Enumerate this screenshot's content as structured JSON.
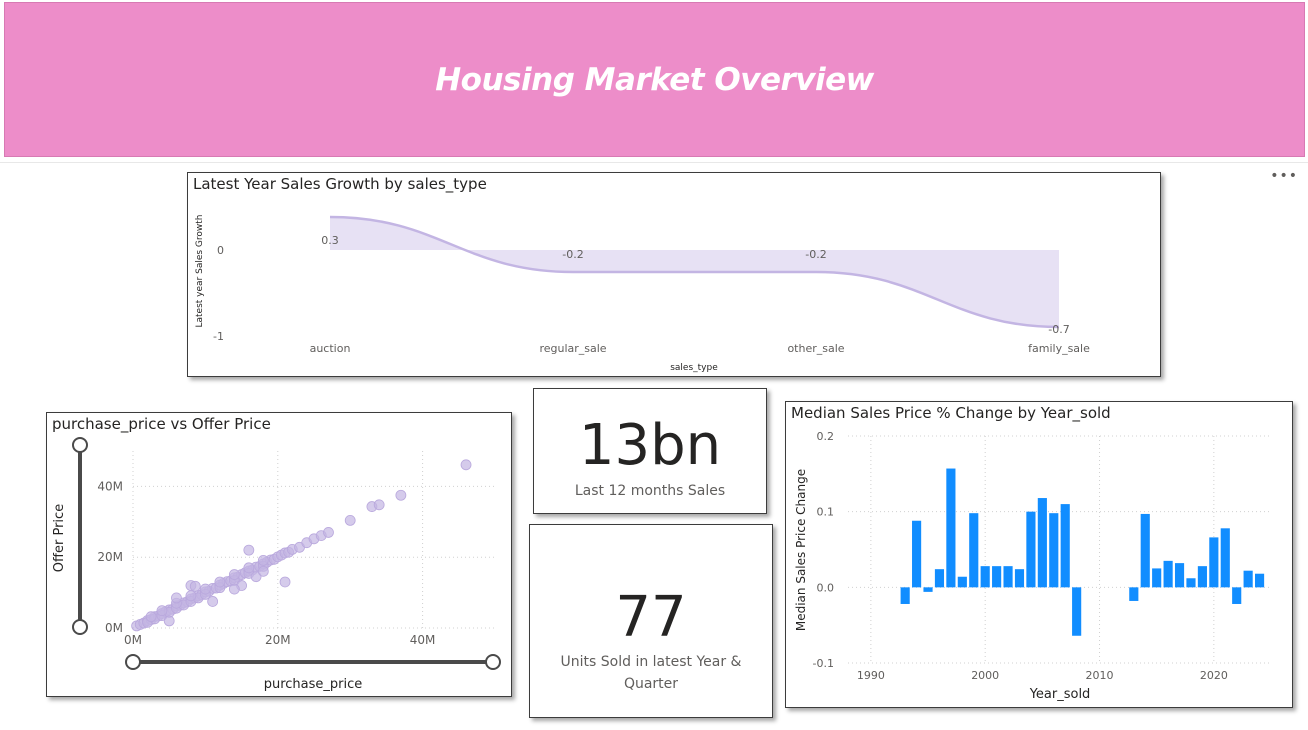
{
  "banner": {
    "title": "Housing Market Overview"
  },
  "visual_options_icon": "more-options-icon",
  "growth_chart": {
    "title": "Latest Year Sales Growth by sales_type",
    "chart_data": {
      "type": "area",
      "title": "Latest Year Sales Growth by sales_type",
      "xlabel": "sales_type",
      "ylabel": "Latest year Sales Growth",
      "categories": [
        "auction",
        "regular_sale",
        "other_sale",
        "family_sale"
      ],
      "values": [
        0.3,
        -0.2,
        -0.2,
        -0.7
      ],
      "data_labels": [
        "0.3",
        "-0.2",
        "-0.2",
        "-0.7"
      ],
      "y_ticks": [
        "0",
        "-1"
      ],
      "grid": false,
      "color": "#c3b5e3"
    }
  },
  "scatter_chart": {
    "title": "purchase_price vs Offer Price",
    "chart_data": {
      "type": "scatter",
      "title": "purchase_price vs Offer Price",
      "xlabel": "purchase_price",
      "ylabel": "Offer Price",
      "xlim": [
        0,
        50
      ],
      "ylim": [
        0,
        50
      ],
      "x_ticks": [
        "0M",
        "20M",
        "40M"
      ],
      "y_ticks": [
        "0M",
        "20M",
        "40M"
      ],
      "grid": true,
      "color": "#c3b5e3",
      "points": [
        [
          0.5,
          0.6
        ],
        [
          1,
          1
        ],
        [
          1.5,
          1.4
        ],
        [
          2,
          2.1
        ],
        [
          2.5,
          2.4
        ],
        [
          3,
          3.2
        ],
        [
          3.5,
          3.4
        ],
        [
          4,
          4.1
        ],
        [
          4.5,
          4.6
        ],
        [
          5,
          5.1
        ],
        [
          5.5,
          5.3
        ],
        [
          6,
          6.2
        ],
        [
          6.5,
          6.4
        ],
        [
          7,
          7.1
        ],
        [
          7.5,
          7.4
        ],
        [
          8,
          8.2
        ],
        [
          8.5,
          8.5
        ],
        [
          9,
          9.1
        ],
        [
          9.5,
          9.4
        ],
        [
          10,
          10.2
        ],
        [
          10.5,
          10.4
        ],
        [
          11,
          11.2
        ],
        [
          11.5,
          11.3
        ],
        [
          12,
          12.1
        ],
        [
          12.5,
          12.6
        ],
        [
          13,
          13.1
        ],
        [
          13.5,
          13.3
        ],
        [
          14,
          14.2
        ],
        [
          14.5,
          14.4
        ],
        [
          15,
          15.1
        ],
        [
          15.5,
          15.6
        ],
        [
          16,
          16.1
        ],
        [
          16.5,
          16.4
        ],
        [
          17,
          17.2
        ],
        [
          17.5,
          17.4
        ],
        [
          18,
          18.1
        ],
        [
          18.5,
          18.6
        ],
        [
          19,
          19.2
        ],
        [
          19.5,
          19.4
        ],
        [
          20,
          20.1
        ],
        [
          20.5,
          20.6
        ],
        [
          21,
          21.2
        ],
        [
          21.5,
          21.4
        ],
        [
          22,
          22.2
        ],
        [
          23,
          22.8
        ],
        [
          24,
          24.1
        ],
        [
          25,
          25.2
        ],
        [
          26,
          26.1
        ],
        [
          27,
          27.0
        ],
        [
          2,
          1.6
        ],
        [
          3,
          2.6
        ],
        [
          4,
          3.5
        ],
        [
          5,
          4.4
        ],
        [
          6,
          5.6
        ],
        [
          7,
          6.5
        ],
        [
          8,
          7.5
        ],
        [
          9,
          8.5
        ],
        [
          10,
          9.5
        ],
        [
          12,
          11.4
        ],
        [
          14,
          13.4
        ],
        [
          16,
          15.4
        ],
        [
          18,
          17.4
        ],
        [
          2.5,
          3.2
        ],
        [
          4,
          4.9
        ],
        [
          6,
          7.0
        ],
        [
          8,
          9.1
        ],
        [
          10,
          11.0
        ],
        [
          12,
          13.0
        ],
        [
          14,
          15.1
        ],
        [
          16,
          17.0
        ],
        [
          18,
          19.1
        ],
        [
          8,
          12
        ],
        [
          8.6,
          11.8
        ],
        [
          15,
          12
        ],
        [
          21,
          13
        ],
        [
          17,
          14.5
        ],
        [
          16,
          22
        ],
        [
          18,
          16
        ],
        [
          14,
          11
        ],
        [
          11,
          7.5
        ],
        [
          5,
          2
        ],
        [
          6,
          8.5
        ],
        [
          30,
          30.4
        ],
        [
          33,
          34.3
        ],
        [
          34,
          34.8
        ],
        [
          37,
          37.5
        ],
        [
          46,
          46.1
        ]
      ]
    }
  },
  "kpi_sales": {
    "value": "13bn",
    "label": "Last 12 months Sales"
  },
  "kpi_units": {
    "value": "77",
    "label_line1": "Units Sold in latest Year &",
    "label_line2": "Quarter"
  },
  "median_chart": {
    "title": "Median Sales Price % Change by Year_sold",
    "chart_data": {
      "type": "bar",
      "title": "Median Sales Price % Change by Year_sold",
      "xlabel": "Year_sold",
      "ylabel": "Median Sales Price Change",
      "xlim": [
        1988,
        2025
      ],
      "ylim": [
        -0.1,
        0.2
      ],
      "x_ticks": [
        "1990",
        "2000",
        "2010",
        "2020"
      ],
      "y_ticks": [
        "0.2",
        "0.1",
        "0.0",
        "-0.1"
      ],
      "grid": true,
      "color": "#118dff",
      "x": [
        1993,
        1994,
        1995,
        1996,
        1997,
        1998,
        1999,
        2000,
        2001,
        2002,
        2003,
        2004,
        2005,
        2006,
        2007,
        2008,
        2013,
        2014,
        2015,
        2016,
        2017,
        2018,
        2019,
        2020,
        2021,
        2022,
        2023,
        2024
      ],
      "values": [
        -0.022,
        0.088,
        -0.006,
        0.024,
        0.157,
        0.014,
        0.098,
        0.028,
        0.028,
        0.028,
        0.024,
        0.1,
        0.118,
        0.098,
        0.11,
        -0.064,
        -0.018,
        0.097,
        0.025,
        0.035,
        0.032,
        0.012,
        0.028,
        0.066,
        0.078,
        -0.022,
        0.022,
        0.018
      ]
    }
  }
}
